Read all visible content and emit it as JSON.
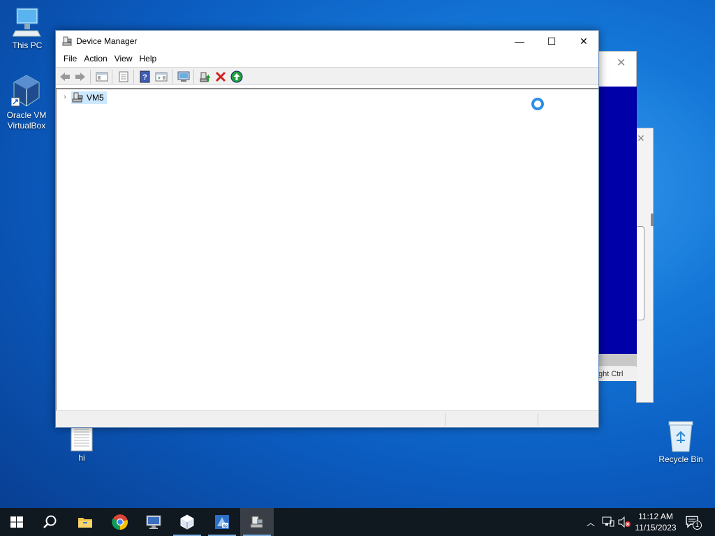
{
  "desktop": {
    "icons": [
      {
        "label": "This PC"
      },
      {
        "label": "Oracle VM VirtualBox"
      },
      {
        "label": "hi"
      },
      {
        "label": "Recycle Bin"
      }
    ]
  },
  "background_window": {
    "status_text": "ght Ctrl"
  },
  "window": {
    "title": "Device Manager",
    "controls": {
      "minimize": "—",
      "maximize": "☐",
      "close": "✕"
    },
    "menu": [
      "File",
      "Action",
      "View",
      "Help"
    ],
    "toolbar_icons": [
      "back-icon",
      "forward-icon",
      "show-hide-console-tree-icon",
      "properties-icon",
      "help-icon",
      "show-hide-action-pane-icon",
      "scan-hardware-icon",
      "update-driver-icon",
      "uninstall-device-icon",
      "enable-device-icon"
    ],
    "tree": {
      "root": {
        "label": "VM5",
        "expanded": false
      }
    }
  },
  "taskbar": {
    "apps": [
      "start-icon",
      "search-icon",
      "file-explorer-icon",
      "chrome-icon",
      "remote-desktop-icon",
      "virtualbox-icon",
      "virtualbox-vm-icon",
      "device-manager-icon"
    ],
    "clock": {
      "time": "11:12 AM",
      "date": "11/15/2023"
    },
    "notification_count": "1"
  },
  "colors": {
    "accent": "#0078d7",
    "selection": "#cce8ff",
    "taskbar": "#101820"
  }
}
